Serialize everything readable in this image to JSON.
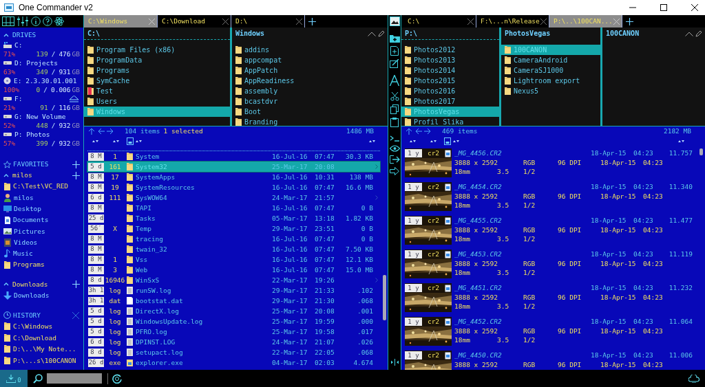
{
  "window": {
    "title": "One Commander v2"
  },
  "sidebar": {
    "drives_heading": "DRIVES",
    "drives": [
      {
        "label": "C:",
        "kind": "system",
        "percent": "71%",
        "used": "139",
        "separator": "/",
        "total": "476",
        "unit": "GB",
        "ejectable": false
      },
      {
        "label": "D: Projects",
        "kind": "hdd",
        "percent": "63%",
        "used": "349",
        "separator": "/",
        "total": "931",
        "unit": "GB",
        "ejectable": false
      },
      {
        "label": "E: 2.3.30.01.001",
        "kind": "disc",
        "percent": "100%",
        "used": "0",
        "separator": "/",
        "total": "0.006",
        "unit": "GB",
        "ejectable": false
      },
      {
        "label": "F:",
        "kind": "hdd",
        "percent": "21%",
        "used": "91",
        "separator": "/",
        "total": "116",
        "unit": "GB",
        "ejectable": true
      },
      {
        "label": "G: New Volume",
        "kind": "hdd",
        "percent": "52%",
        "used": "448",
        "separator": "/",
        "total": "932",
        "unit": "GB",
        "ejectable": false
      },
      {
        "label": "P: Photos",
        "kind": "hdd",
        "percent": "57%",
        "used": "399",
        "separator": "/",
        "total": "932",
        "unit": "GB",
        "ejectable": false
      }
    ],
    "favorites_heading": "FAVORITES",
    "favorite_groups": [
      {
        "name": "milos",
        "expanded": true,
        "items": [
          {
            "label": "C:\\Test\\VC_RED",
            "kind": "folder"
          },
          {
            "label": "milos",
            "kind": "user"
          },
          {
            "label": "Desktop",
            "kind": "desktop"
          },
          {
            "label": "Documents",
            "kind": "documents"
          },
          {
            "label": "Pictures",
            "kind": "pictures"
          },
          {
            "label": "Videos",
            "kind": "videos"
          },
          {
            "label": "Music",
            "kind": "music"
          },
          {
            "label": "Programs",
            "kind": "folder"
          }
        ]
      },
      {
        "name": "Downloads",
        "expanded": true,
        "items": [
          {
            "label": "Downloads",
            "kind": "download"
          }
        ]
      }
    ],
    "history_heading": "HISTORY",
    "history": [
      "C:\\Windows",
      "C:\\Download",
      "D:\\..\\My Note...",
      "P:\\...s\\100CANON"
    ]
  },
  "left_pane": {
    "tabs": [
      {
        "label": "C:\\Windows",
        "selected": true
      },
      {
        "label": "C:\\Download",
        "selected": false
      },
      {
        "label": "D:\\",
        "selected": false
      }
    ],
    "columns": [
      {
        "title": "C:\\",
        "items": [
          {
            "name": "Program Files (x86)",
            "kind": "folder",
            "selected": false
          },
          {
            "name": "ProgramData",
            "kind": "folder",
            "selected": false
          },
          {
            "name": "Programs",
            "kind": "folder",
            "selected": false
          },
          {
            "name": "SymCache",
            "kind": "folder",
            "selected": false
          },
          {
            "name": "Test",
            "kind": "flagged",
            "selected": false
          },
          {
            "name": "Users",
            "kind": "folder",
            "selected": false
          },
          {
            "name": "Windows",
            "kind": "folder",
            "selected": true
          }
        ]
      },
      {
        "title": "Windows",
        "items": [
          {
            "name": "addins",
            "kind": "folder",
            "selected": false
          },
          {
            "name": "appcompat",
            "kind": "folder",
            "selected": false
          },
          {
            "name": "AppPatch",
            "kind": "folder",
            "selected": false
          },
          {
            "name": "AppReadiness",
            "kind": "folder",
            "selected": false
          },
          {
            "name": "assembly",
            "kind": "folder",
            "selected": false
          },
          {
            "name": "bcastdvr",
            "kind": "folder",
            "selected": false
          },
          {
            "name": "Boot",
            "kind": "folder",
            "selected": false
          },
          {
            "name": "Branding",
            "kind": "folder",
            "selected": false
          }
        ]
      }
    ],
    "status": {
      "count": "104 items",
      "selection": "1 selected",
      "size": "1486 MB"
    },
    "rows": [
      {
        "age": "8 M",
        "count": "1",
        "name": "System",
        "kind": "folder",
        "date": "16-Jul-16",
        "time": "07:47",
        "size": "30.3 KB",
        "selected": false,
        "expandable": false
      },
      {
        "age": "5 d",
        "count": "161",
        "name": "System32",
        "kind": "folder",
        "date": "25-Mar-17",
        "time": "20:08",
        "selected": true,
        "expandable": true
      },
      {
        "age": "8 M",
        "count": "17",
        "name": "SystemApps",
        "kind": "folder",
        "date": "16-Jul-16",
        "time": "10:31",
        "size": "138 MB",
        "selected": false,
        "expandable": false
      },
      {
        "age": "8 M",
        "count": "19",
        "name": "SystemResources",
        "kind": "folder",
        "date": "16-Jul-16",
        "time": "07:47",
        "size": "16.6 MB",
        "selected": false,
        "expandable": false
      },
      {
        "age": "6 d",
        "count": "111",
        "name": "SysWOW64",
        "kind": "folder",
        "date": "24-Mar-17",
        "time": "21:57",
        "selected": false,
        "expandable": true
      },
      {
        "age": "8 M",
        "name": "TAPI",
        "kind": "folder",
        "date": "16-Jul-16",
        "time": "07:47",
        "size": "0 B",
        "selected": false,
        "expandable": false
      },
      {
        "age": "25 d",
        "name": "Tasks",
        "kind": "folder",
        "date": "05-Mar-17",
        "time": "13:18",
        "size": "1.82 KB",
        "selected": false,
        "expandable": false
      },
      {
        "age": "56′",
        "count": "X",
        "name": "Temp",
        "kind": "folder",
        "date": "29-Mar-17",
        "time": "23:51",
        "size": "0 B",
        "selected": false,
        "expandable": false
      },
      {
        "age": "8 M",
        "name": "tracing",
        "kind": "folder",
        "date": "16-Jul-16",
        "time": "07:47",
        "size": "0 B",
        "selected": false,
        "expandable": false
      },
      {
        "age": "8 M",
        "name": "twain_32",
        "kind": "folder",
        "date": "16-Jul-16",
        "time": "07:47",
        "size": "7.50 KB",
        "selected": false,
        "expandable": false
      },
      {
        "age": "8 M",
        "count": "1",
        "name": "Vss",
        "kind": "folder",
        "date": "16-Jul-16",
        "time": "07:47",
        "size": "12.1 KB",
        "selected": false,
        "expandable": false
      },
      {
        "age": "8 M",
        "count": "3",
        "name": "Web",
        "kind": "folder",
        "date": "16-Jul-16",
        "time": "07:47",
        "size": "15.0 MB",
        "selected": false,
        "expandable": false
      },
      {
        "age": "8 d",
        "count": "16946",
        "name": "WinSxS",
        "kind": "folder",
        "date": "22-Mar-17",
        "time": "19:26",
        "selected": false,
        "expandable": true
      },
      {
        "age": "3h 1",
        "count": "log",
        "name": "runSW.log",
        "kind": "text",
        "date": "29-Mar-17",
        "time": "21:33",
        "size": ".102",
        "selected": false,
        "expandable": false
      },
      {
        "age": "3h 1",
        "count": "dat",
        "name": "bootstat.dat",
        "kind": "blank",
        "date": "29-Mar-17",
        "time": "21:30",
        "size": ".068",
        "selected": false,
        "expandable": false
      },
      {
        "age": "5 d",
        "count": "log",
        "name": "DirectX.log",
        "kind": "text",
        "date": "25-Mar-17",
        "time": "20:08",
        "size": ".001",
        "selected": false,
        "expandable": false
      },
      {
        "age": "5 d",
        "count": "log",
        "name": "WindowsUpdate.log",
        "kind": "text",
        "date": "25-Mar-17",
        "time": "19:59",
        "size": ".000",
        "selected": false,
        "expandable": false
      },
      {
        "age": "5 d",
        "count": "log",
        "name": "PFRO.log",
        "kind": "text",
        "date": "25-Mar-17",
        "time": "19:58",
        "size": ".017",
        "selected": false,
        "expandable": false
      },
      {
        "age": "6 d",
        "count": "log",
        "name": "DPINST.LOG",
        "kind": "text",
        "date": "24-Mar-17",
        "time": "21:07",
        "size": ".026",
        "selected": false,
        "expandable": false
      },
      {
        "age": "8 d",
        "count": "log",
        "name": "setupact.log",
        "kind": "text",
        "date": "22-Mar-17",
        "time": "22:05",
        "size": ".068",
        "selected": false,
        "expandable": false
      },
      {
        "age": "26 d",
        "count": "exe",
        "name": "explorer.exe",
        "kind": "program",
        "date": "04-Mar-17",
        "time": "02:03",
        "size": "4.674",
        "selected": false,
        "expandable": false
      }
    ]
  },
  "right_pane": {
    "tabs": [
      {
        "label": "C:\\",
        "selected": false
      },
      {
        "label": "F:\\...n\\Release",
        "selected": false
      },
      {
        "label": "P:\\..\\100CAN...",
        "selected": true
      }
    ],
    "columns": [
      {
        "title": "P:\\",
        "items": [
          {
            "name": "Photos2012",
            "kind": "folder",
            "selected": false
          },
          {
            "name": "Photos2013",
            "kind": "folder",
            "selected": false
          },
          {
            "name": "Photos2014",
            "kind": "folder",
            "selected": false
          },
          {
            "name": "Photos2015",
            "kind": "folder",
            "selected": false
          },
          {
            "name": "Photos2016",
            "kind": "folder",
            "selected": false
          },
          {
            "name": "Photos2017",
            "kind": "folder",
            "selected": false
          },
          {
            "name": "PhotosVegas",
            "kind": "folder",
            "selected": true
          },
          {
            "name": "Profil Slika",
            "kind": "folder",
            "selected": false
          }
        ]
      },
      {
        "title": "PhotosVegas",
        "items": [
          {
            "name": "100CANON",
            "kind": "folder",
            "selected": true
          },
          {
            "name": "CameraAndroid",
            "kind": "folder",
            "selected": false
          },
          {
            "name": "CameraSJ1000",
            "kind": "folder",
            "selected": false
          },
          {
            "name": "Lightroom export",
            "kind": "folder",
            "selected": false
          },
          {
            "name": "Nexus5",
            "kind": "folder",
            "selected": false
          }
        ]
      },
      {
        "title": "100CANON"
      }
    ],
    "status": {
      "count": "469 items",
      "size": "2182 MB"
    },
    "photos": [
      {
        "age": "1 y",
        "ext": "cr2",
        "name": "_MG_4456.CR2",
        "date": "18-Apr-15",
        "time": "04:23",
        "size": "11.757",
        "dims": "3888 x 2592",
        "mode": "RGB",
        "dpi": "96 DPI",
        "taken_date": "18-Apr-15",
        "taken_time": "04:23",
        "focal": "18mm",
        "fnumber": "3.5",
        "exposure": "1/2"
      },
      {
        "age": "1 y",
        "ext": "cr2",
        "name": "_MG_4454.CR2",
        "date": "18-Apr-15",
        "time": "04:23",
        "size": "11.340",
        "dims": "3888 x 2592",
        "mode": "RGB",
        "dpi": "96 DPI",
        "taken_date": "18-Apr-15",
        "taken_time": "04:23",
        "focal": "18mm",
        "fnumber": "3.5",
        "exposure": "1/2"
      },
      {
        "age": "1 y",
        "ext": "cr2",
        "name": "_MG_4455.CR2",
        "date": "18-Apr-15",
        "time": "04:23",
        "size": "11.477",
        "dims": "3888 x 2592",
        "mode": "RGB",
        "dpi": "96 DPI",
        "taken_date": "18-Apr-15",
        "taken_time": "04:23",
        "focal": "18mm",
        "fnumber": "3.5",
        "exposure": "1/2"
      },
      {
        "age": "1 y",
        "ext": "cr2",
        "name": "_MG_4453.CR2",
        "date": "18-Apr-15",
        "time": "04:23",
        "size": "11.119",
        "dims": "3888 x 2592",
        "mode": "RGB",
        "dpi": "96 DPI",
        "taken_date": "18-Apr-15",
        "taken_time": "04:23",
        "focal": "18mm",
        "fnumber": "3.5",
        "exposure": "1/2"
      },
      {
        "age": "1 y",
        "ext": "cr2",
        "name": "_MG_4451.CR2",
        "date": "18-Apr-15",
        "time": "04:23",
        "size": "11.232",
        "dims": "3888 x 2592",
        "mode": "RGB",
        "dpi": "96 DPI",
        "taken_date": "18-Apr-15",
        "taken_time": "04:23",
        "focal": "18mm",
        "fnumber": "3.5",
        "exposure": "1/2"
      },
      {
        "age": "1 y",
        "ext": "cr2",
        "name": "_MG_4452.CR2",
        "date": "18-Apr-15",
        "time": "04:23",
        "size": "11.064",
        "dims": "3888 x 2592",
        "mode": "RGB",
        "dpi": "96 DPI",
        "taken_date": "18-Apr-15",
        "taken_time": "04:23",
        "focal": "18mm",
        "fnumber": "3.5",
        "exposure": "1/2"
      },
      {
        "age": "1 y",
        "ext": "cr2",
        "name": "_MG_4450.CR2",
        "date": "18-Apr-15",
        "time": "04:23",
        "size": "11.006",
        "dims": "3888 x 2592",
        "mode": "RGB",
        "dpi": "96 DPI",
        "taken_date": "18-Apr-15",
        "taken_time": "04:23"
      }
    ]
  },
  "bottom_bar": {
    "downloads_count": "0"
  }
}
